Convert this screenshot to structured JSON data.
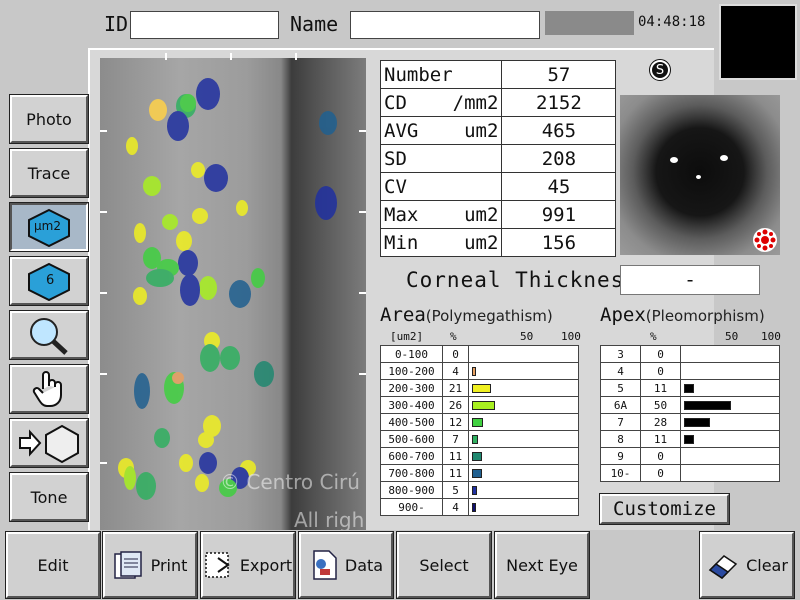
{
  "header": {
    "id_label": "ID",
    "name_label": "Name",
    "id_value": "",
    "name_value": "",
    "time": "04:48:18"
  },
  "side_buttons": {
    "photo": "Photo",
    "trace": "Trace",
    "unit_um2": "μm2",
    "six": "6",
    "tone": "Tone"
  },
  "stats": [
    {
      "label": "Number",
      "value": "57"
    },
    {
      "label": "CD    /mm2",
      "value": "2152"
    },
    {
      "label": "AVG    um2",
      "value": "465"
    },
    {
      "label": "SD",
      "value": "208"
    },
    {
      "label": "CV",
      "value": "45"
    },
    {
      "label": "Max    um2",
      "value": "991"
    },
    {
      "label": "Min    um2",
      "value": "156"
    }
  ],
  "corneal": {
    "label": "Corneal Thickness",
    "value": "-"
  },
  "s_badge": "S",
  "area": {
    "title": "Area",
    "subtitle": "(Polymegathism)",
    "unit": "[um2]",
    "pct": "%",
    "s50": "50",
    "s100": "100",
    "rows": [
      {
        "range": "0-100",
        "pct": "0",
        "fill": 0,
        "color": "#ffffff"
      },
      {
        "range": "100-200",
        "pct": "4",
        "fill": 4,
        "color": "#e8a060"
      },
      {
        "range": "200-300",
        "pct": "21",
        "fill": 21,
        "color": "#f0f020"
      },
      {
        "range": "300-400",
        "pct": "26",
        "fill": 26,
        "color": "#a8f020"
      },
      {
        "range": "400-500",
        "pct": "12",
        "fill": 12,
        "color": "#40d040"
      },
      {
        "range": "500-600",
        "pct": "7",
        "fill": 7,
        "color": "#30b060"
      },
      {
        "range": "600-700",
        "pct": "11",
        "fill": 11,
        "color": "#208870"
      },
      {
        "range": "700-800",
        "pct": "11",
        "fill": 11,
        "color": "#206090"
      },
      {
        "range": "800-900",
        "pct": "5",
        "fill": 5,
        "color": "#2030a0"
      },
      {
        "range": "900-",
        "pct": "4",
        "fill": 4,
        "color": "#101070"
      }
    ]
  },
  "apex": {
    "title": "Apex",
    "subtitle": "(Pleomorphism)",
    "pct": "%",
    "s50": "50",
    "s100": "100",
    "rows": [
      {
        "k": "3",
        "pct": "0",
        "fill": 0
      },
      {
        "k": "4",
        "pct": "0",
        "fill": 0
      },
      {
        "k": "5",
        "pct": "11",
        "fill": 11
      },
      {
        "k": "6A",
        "pct": "50",
        "fill": 50
      },
      {
        "k": "7",
        "pct": "28",
        "fill": 28
      },
      {
        "k": "8",
        "pct": "11",
        "fill": 11
      },
      {
        "k": "9",
        "pct": "0",
        "fill": 0
      },
      {
        "k": "10-",
        "pct": "0",
        "fill": 0
      }
    ]
  },
  "customize": "Customize",
  "watermark": {
    "line1": "© Centro Cirú",
    "line2": "All righ"
  },
  "bottom": {
    "edit": "Edit",
    "print": "Print",
    "export": "Export",
    "data": "Data",
    "select": "Select",
    "next_eye": "Next Eye",
    "clear": "Clear"
  }
}
